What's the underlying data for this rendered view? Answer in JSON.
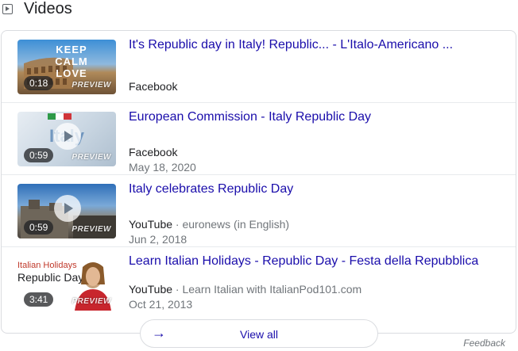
{
  "header": {
    "title": "Videos",
    "icon": "video-play-icon"
  },
  "videos": [
    {
      "title": "It's Republic day in Italy! Republic... - L'Italo-Americano ...",
      "duration": "0:18",
      "preview_label": "PREVIEW",
      "source": "Facebook",
      "channel": "",
      "date": "",
      "thumb_text": "KEEP CALM LOVE"
    },
    {
      "title": "European Commission - Italy Republic Day",
      "duration": "0:59",
      "preview_label": "PREVIEW",
      "source": "Facebook",
      "channel": "",
      "date": "May 18, 2020",
      "thumb_text": "Italy"
    },
    {
      "title": "Italy celebrates Republic Day",
      "duration": "0:59",
      "preview_label": "PREVIEW",
      "source": "YouTube",
      "channel": "euronews (in English)",
      "date": "Jun 2, 2018"
    },
    {
      "title": "Learn Italian Holidays - Republic Day - Festa della Repubblica",
      "duration": "3:41",
      "preview_label": "PREVIEW",
      "source": "YouTube",
      "channel": "Learn Italian with ItalianPod101.com",
      "date": "Oct 21, 2013",
      "thumb_text_1": "Italian Holidays",
      "thumb_text_2": "Republic Day"
    }
  ],
  "separator": "·",
  "view_all": {
    "label": "View all",
    "icon": "arrow-right-icon"
  },
  "feedback": "Feedback",
  "colors": {
    "link": "#1a0dab",
    "meta": "#70757a",
    "border": "#dadce0"
  }
}
